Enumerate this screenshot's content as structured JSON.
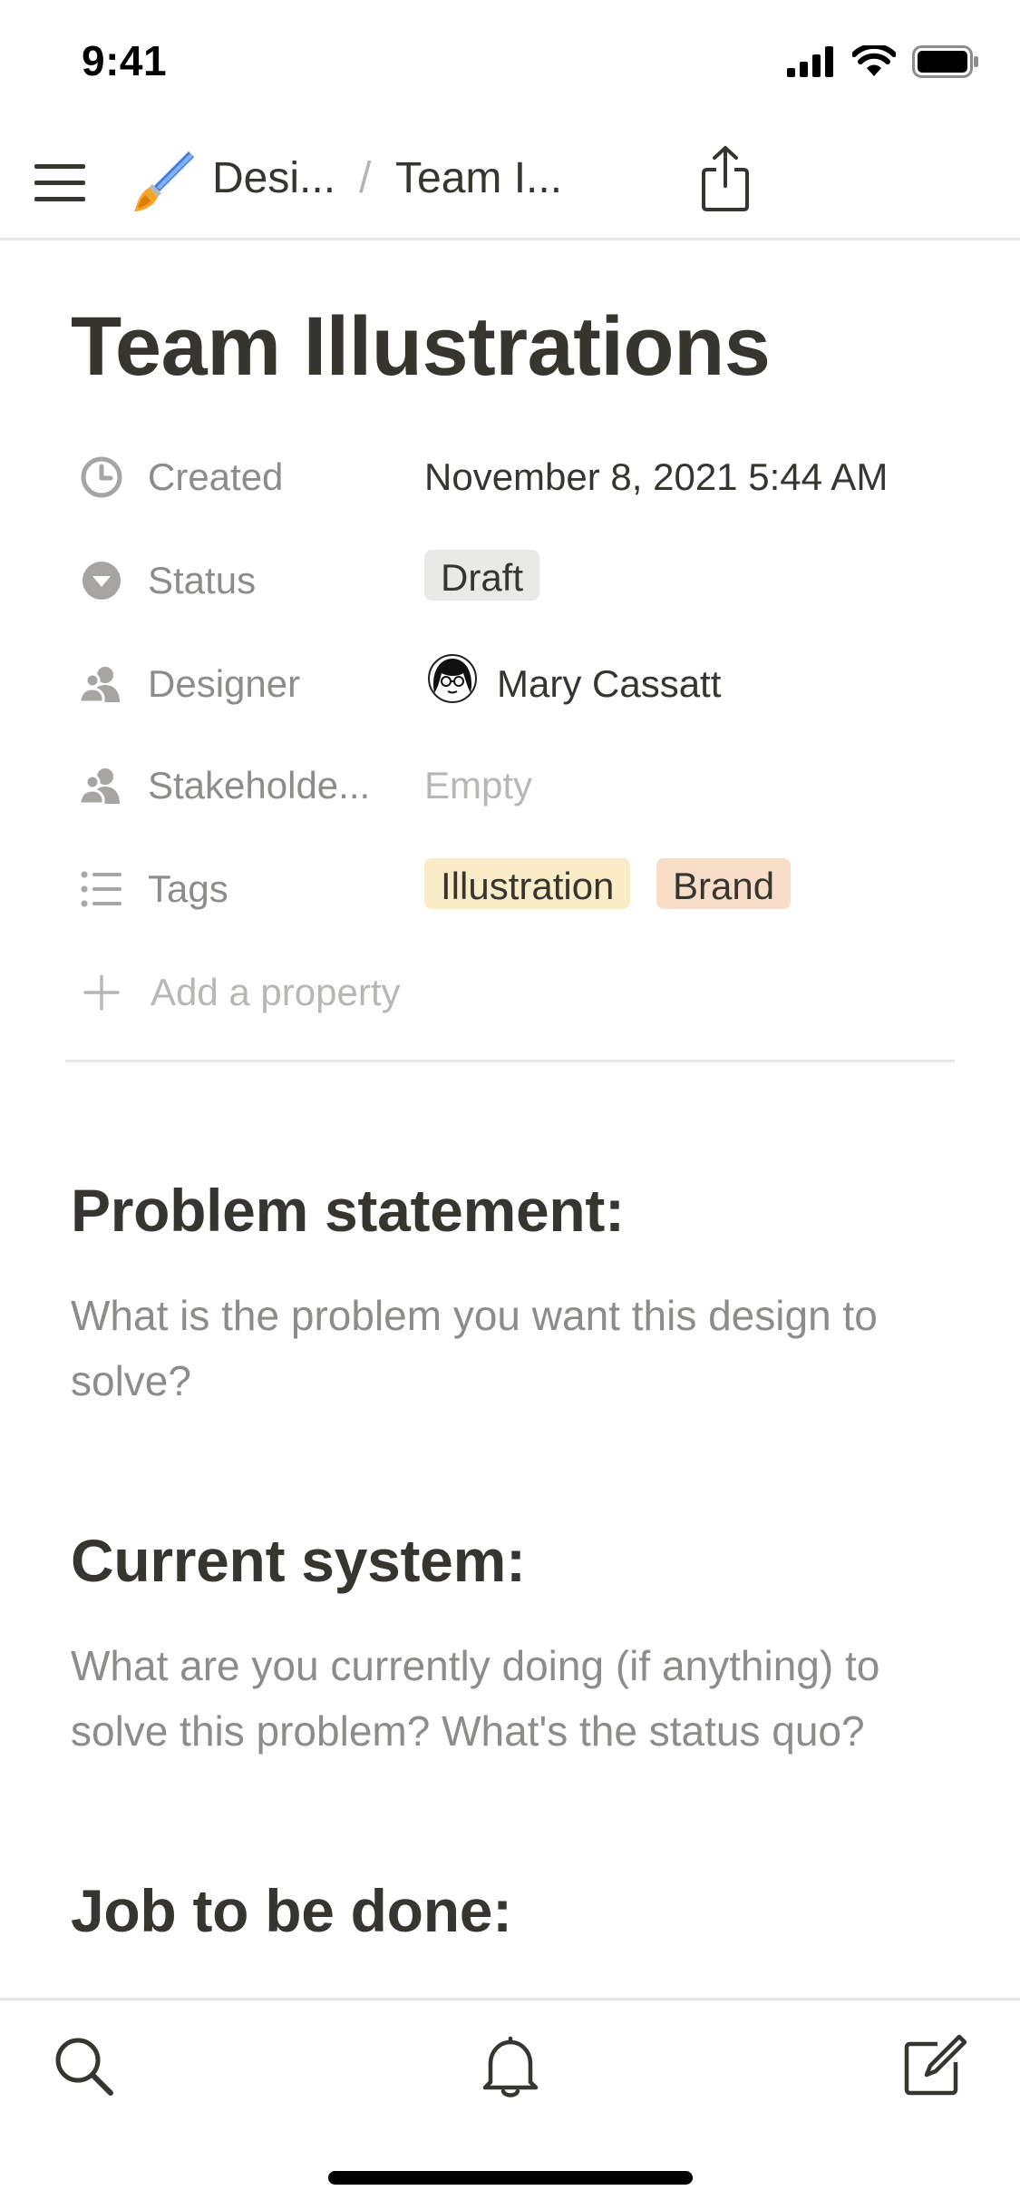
{
  "status_bar": {
    "time": "9:41",
    "icons": [
      "cellular-signal-icon",
      "wifi-icon",
      "battery-icon"
    ]
  },
  "nav": {
    "menu_icon": "hamburger-menu-icon",
    "breadcrumb_icon": "paintbrush-emoji-icon",
    "breadcrumb_1": "Desi...",
    "separator": "/",
    "breadcrumb_2": "Team I...",
    "share_icon": "share-icon"
  },
  "page": {
    "title": "Team Illustrations"
  },
  "properties": {
    "created": {
      "icon": "clock-icon",
      "label": "Created",
      "value": "November 8, 2021 5:44 AM"
    },
    "status": {
      "icon": "status-dropdown-icon",
      "label": "Status",
      "value": "Draft"
    },
    "designer": {
      "icon": "person-icon",
      "label": "Designer",
      "value": "Mary Cassatt"
    },
    "stakeholders": {
      "icon": "person-icon",
      "label": "Stakeholde...",
      "value": "Empty"
    },
    "tags": {
      "icon": "list-icon",
      "label": "Tags",
      "values": [
        "Illustration",
        "Brand"
      ]
    },
    "add_property": {
      "icon": "plus-icon",
      "label": "Add a property"
    }
  },
  "sections": [
    {
      "heading": "Problem statement:",
      "body": "What is the problem you want this design to solve?"
    },
    {
      "heading": "Current system:",
      "body": "What are you currently doing (if anything) to solve this problem? What's the status quo?"
    },
    {
      "heading": "Job to be done:",
      "body": ""
    }
  ],
  "bottom_bar": {
    "icons": [
      "search-icon",
      "bell-icon",
      "compose-icon"
    ]
  },
  "colors": {
    "text": "#37352f",
    "muted": "#8e8c88",
    "divider": "#e6e6e4",
    "tag_draft": "#e9e9e7",
    "tag_illustration": "#fbecc8",
    "tag_brand": "#f8ddc8"
  }
}
